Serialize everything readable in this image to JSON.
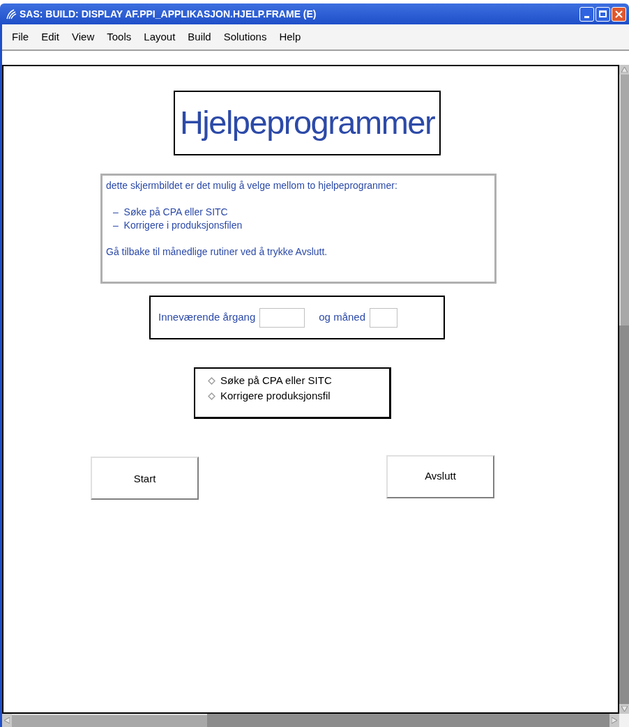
{
  "window": {
    "title": "SAS: BUILD: DISPLAY AF.PPI_APPLIKASJON.HJELP.FRAME (E)"
  },
  "menu": [
    "File",
    "Edit",
    "View",
    "Tools",
    "Layout",
    "Build",
    "Solutions",
    "Help"
  ],
  "heading": "Hjelpeprogrammer",
  "info": {
    "intro": "dette skjermbildet er det mulig å velge mellom to hjelpeprogranmer:",
    "items": [
      "–  Søke på CPA eller SITC",
      "–  Korrigere i produksjonsfilen"
    ],
    "outro": "Gå tilbake til månedlige rutiner ved å trykke Avslutt."
  },
  "fields": [
    {
      "label": "Inneværende årgang"
    },
    {
      "label": "og måned"
    }
  ],
  "options": [
    {
      "label": "Søke på CPA eller SITC",
      "selected": false
    },
    {
      "label": "Korrigere produksjonsfil",
      "selected": false
    }
  ],
  "buttons": [
    "Start",
    "Avslutt"
  ]
}
